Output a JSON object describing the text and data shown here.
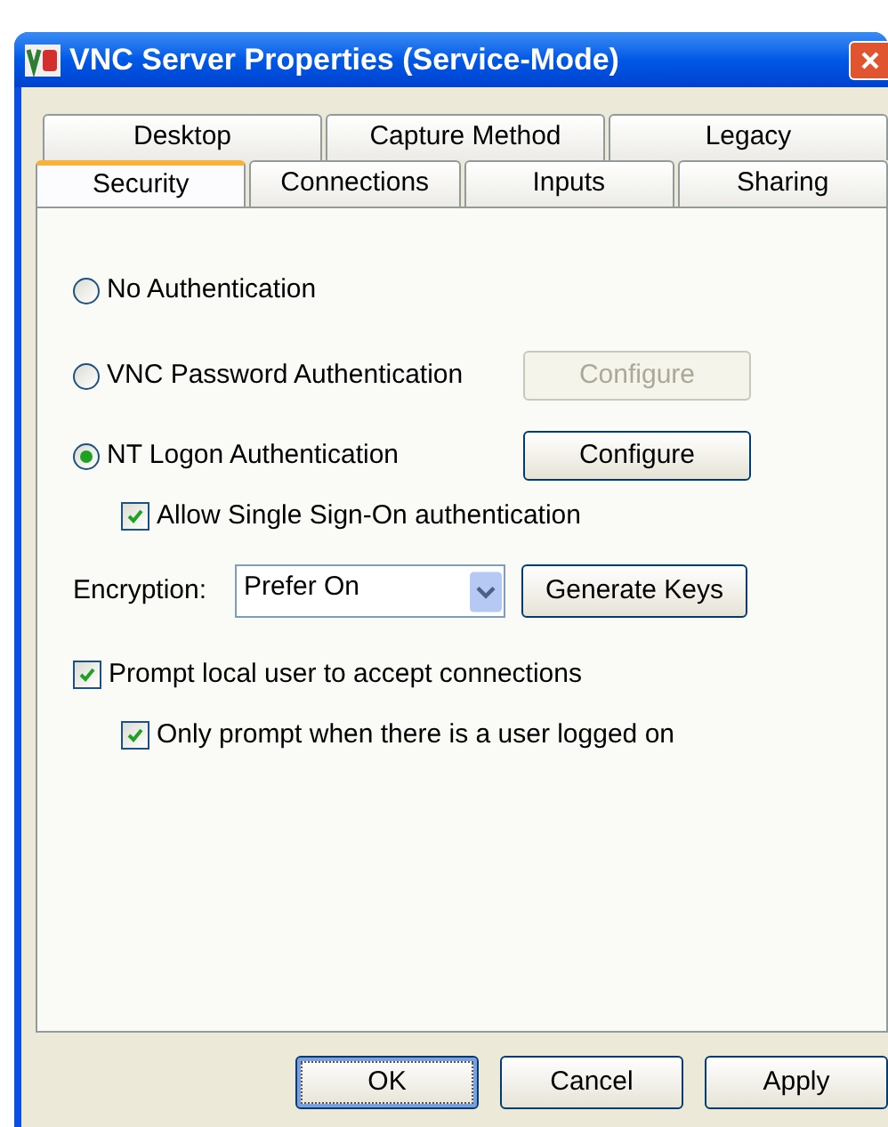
{
  "window": {
    "title": "VNC Server Properties (Service-Mode)"
  },
  "tab_rows": [
    [
      {
        "label": "Desktop",
        "selected": false
      },
      {
        "label": "Capture Method",
        "selected": false
      },
      {
        "label": "Legacy",
        "selected": false
      }
    ],
    [
      {
        "label": "Security",
        "selected": true
      },
      {
        "label": "Connections",
        "selected": false
      },
      {
        "label": "Inputs",
        "selected": false
      },
      {
        "label": "Sharing",
        "selected": false
      }
    ]
  ],
  "options": [
    {
      "kind": "radio",
      "label": "No Authentication",
      "selected": false
    },
    {
      "kind": "radio",
      "label": "VNC Password Authentication",
      "selected": false,
      "button": {
        "label": "Configure",
        "disabled": true
      }
    },
    {
      "kind": "radio",
      "label": "NT Logon Authentication",
      "selected": true,
      "button": {
        "label": "Configure",
        "disabled": false
      }
    },
    {
      "kind": "checkbox",
      "label": "Allow Single Sign-On authentication",
      "checked": true,
      "indented": true
    },
    {
      "kind": "select",
      "label": "Encryption:",
      "value": "Prefer On",
      "button": {
        "label": "Generate Keys",
        "disabled": false
      }
    },
    {
      "kind": "checkbox",
      "label": "Prompt local user to accept connections",
      "checked": true,
      "indented": false
    },
    {
      "kind": "checkbox",
      "label": "Only prompt when there is a user logged on",
      "checked": true,
      "indented": true
    }
  ],
  "buttons": [
    {
      "label": "OK",
      "default": true
    },
    {
      "label": "Cancel",
      "default": false
    },
    {
      "label": "Apply",
      "default": false
    }
  ]
}
